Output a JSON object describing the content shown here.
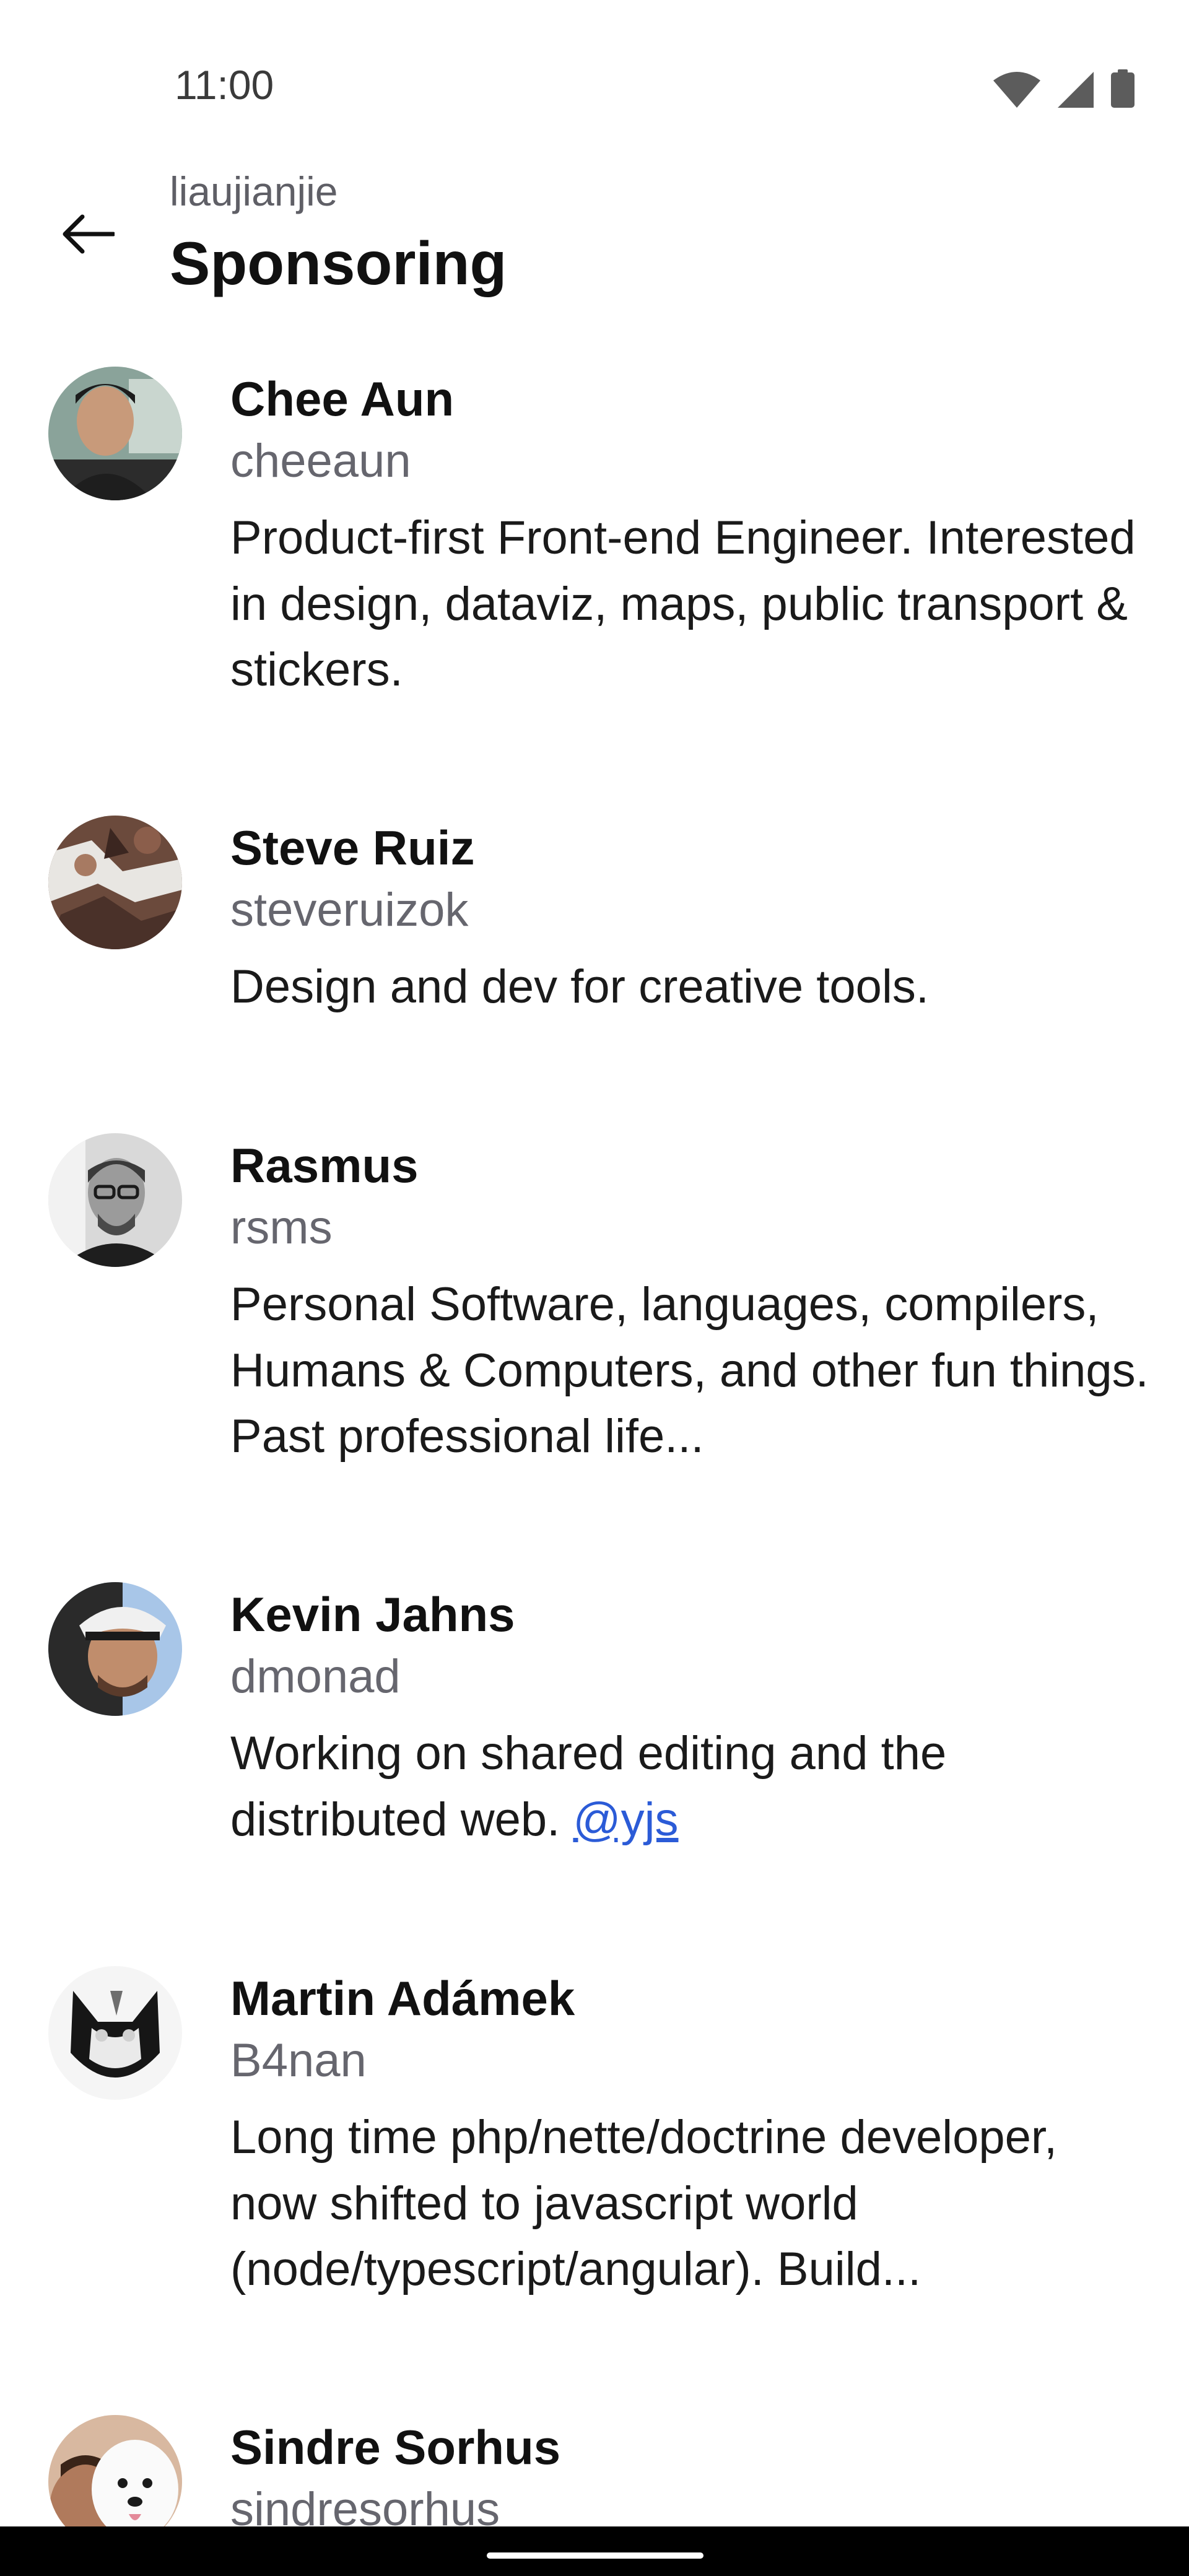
{
  "status_bar": {
    "time": "11:00",
    "icons": [
      "wifi-icon",
      "cellular-signal-icon",
      "battery-icon"
    ]
  },
  "app_bar": {
    "subtitle": "liaujianjie",
    "title": "Sponsoring",
    "back_icon": "arrow-left-icon"
  },
  "sponsors": [
    {
      "name": "Chee Aun",
      "login": "cheeaun",
      "bio": "Product-first Front-end Engineer. Interested in design, dataviz, maps, public transport & stickers."
    },
    {
      "name": "Steve Ruiz",
      "login": "steveruizok",
      "bio": "Design and dev for creative tools."
    },
    {
      "name": "Rasmus",
      "login": "rsms",
      "bio": "Personal Software, languages, compilers, Humans & Computers, and other fun things. Past professional life..."
    },
    {
      "name": " Kevin Jahns",
      "login": "dmonad",
      "bio": "Working on shared editing and the distributed web. ",
      "bio_link": "@yjs"
    },
    {
      "name": "Martin Adámek",
      "login": "B4nan",
      "bio": "Long time php/nette/doctrine developer, now shifted to javascript world (node/typescript/angular). Build..."
    },
    {
      "name": "Sindre Sorhus",
      "login": "sindresorhus"
    }
  ],
  "colors": {
    "link": "#2b5bd7",
    "secondary_text": "#66666e",
    "nav_bar": "#000000"
  }
}
